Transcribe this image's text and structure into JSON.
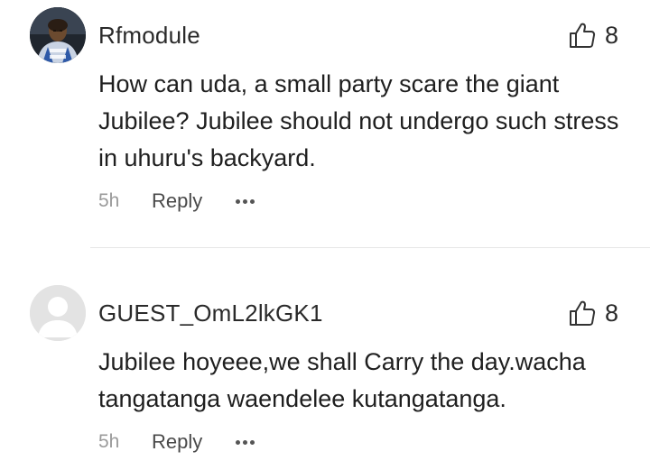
{
  "comments": [
    {
      "username": "Rfmodule",
      "avatar": "user-photo",
      "likes": "8",
      "text": "How can uda, a small party scare the giant Jubilee? Jubilee should not undergo such stress in uhuru's backyard.",
      "time": "5h",
      "reply_label": "Reply",
      "more_icon": "more-dots-icon"
    },
    {
      "username": "GUEST_OmL2lkGK1",
      "avatar": "default-avatar",
      "likes": "8",
      "text": "Jubilee hoyeee,we shall Carry the day.wacha tangatanga waendelee kutangatanga.",
      "time": "5h",
      "reply_label": "Reply",
      "more_icon": "more-dots-icon"
    }
  ],
  "colors": {
    "text": "#1f1f1f",
    "muted": "#9a9a9a",
    "divider": "#e6e6e6"
  }
}
